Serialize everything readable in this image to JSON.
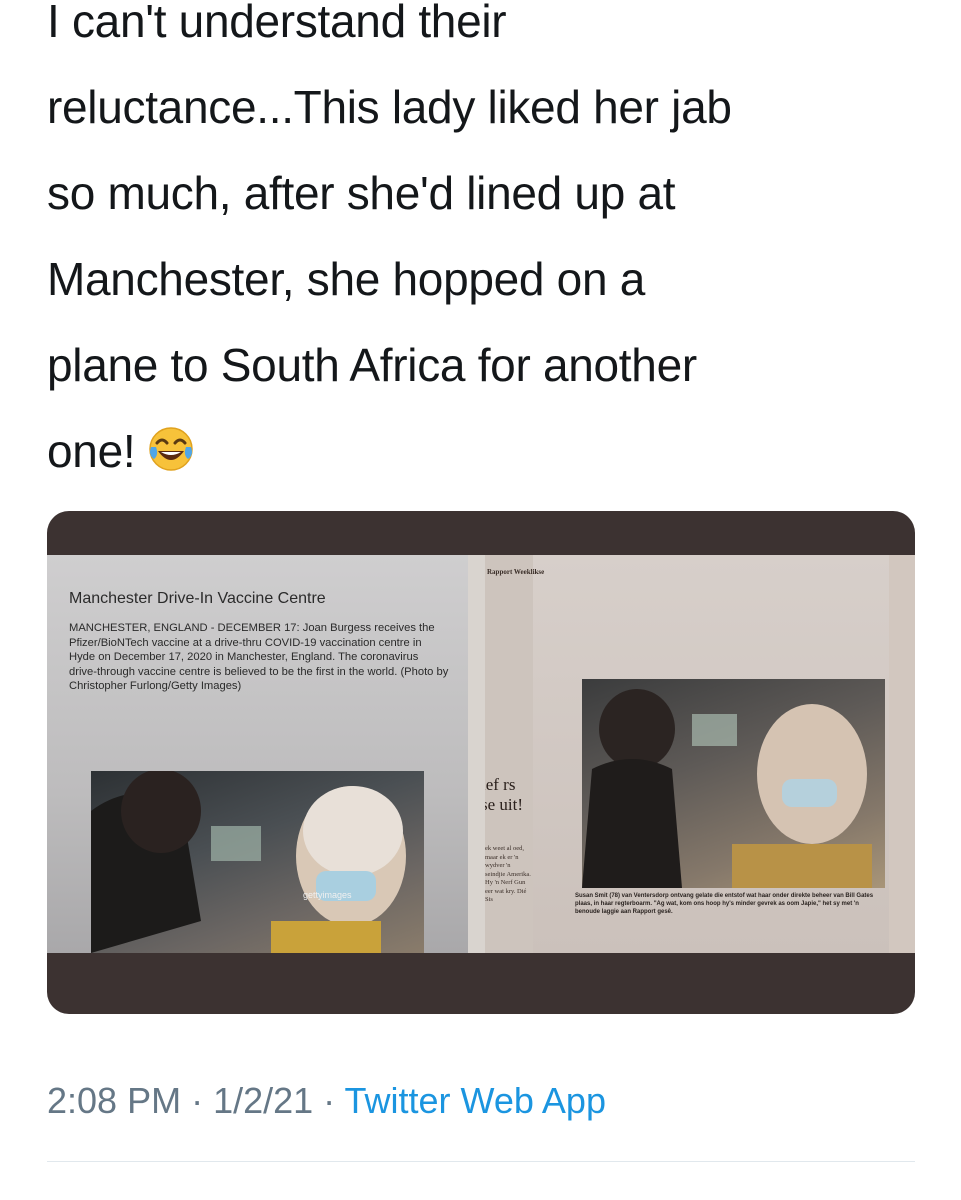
{
  "tweet": {
    "lines": [
      "I can't understand their",
      "reluctance...This lady liked her jab",
      "so much, after she'd lined up at",
      "Manchester, she hopped on a",
      "plane to South Africa for another",
      "one!"
    ],
    "emoji": "face-with-tears-of-joy"
  },
  "media": {
    "left_image": {
      "title": "Manchester Drive-In Vaccine Centre",
      "caption": "MANCHESTER, ENGLAND - DECEMBER 17: Joan Burgess receives the Pfizer/BioNTech vaccine at a drive-thru COVID-19 vaccination centre in Hyde on December 17, 2020 in Manchester, England. The coronavirus drive-through vaccine centre is believed to be the first in the world. (Photo by Christopher Furlong/Getty Images)",
      "watermark": "gettyimages"
    },
    "right_image": {
      "masthead": "Rapport Weeklikse",
      "headline_fragment": "ief rs se uit!",
      "column_text": "ek weet al oed, maar ek er 'n wydver 'n seindjie Amerika. Hy 'n Nerf Gun eer wat kry. Dié Sis",
      "caption": "Susan Smit (78) van Ventersdorp ontvang gelate die entstof wat haar onder direkte beheer van Bill Gates plaas, in haar regterboarm. \"Ag wat, kom ons hoop hy's minder gevrek as oom Japie,\" het sy met 'n benoude laggie aan Rapport gesê."
    }
  },
  "footer": {
    "time": "2:08 PM",
    "separator": " · ",
    "date": "1/2/21",
    "app": "Twitter Web App"
  },
  "colors": {
    "text": "#14171a",
    "meta": "#657786",
    "link": "#1b95e0",
    "card_bg": "#3c3231"
  }
}
